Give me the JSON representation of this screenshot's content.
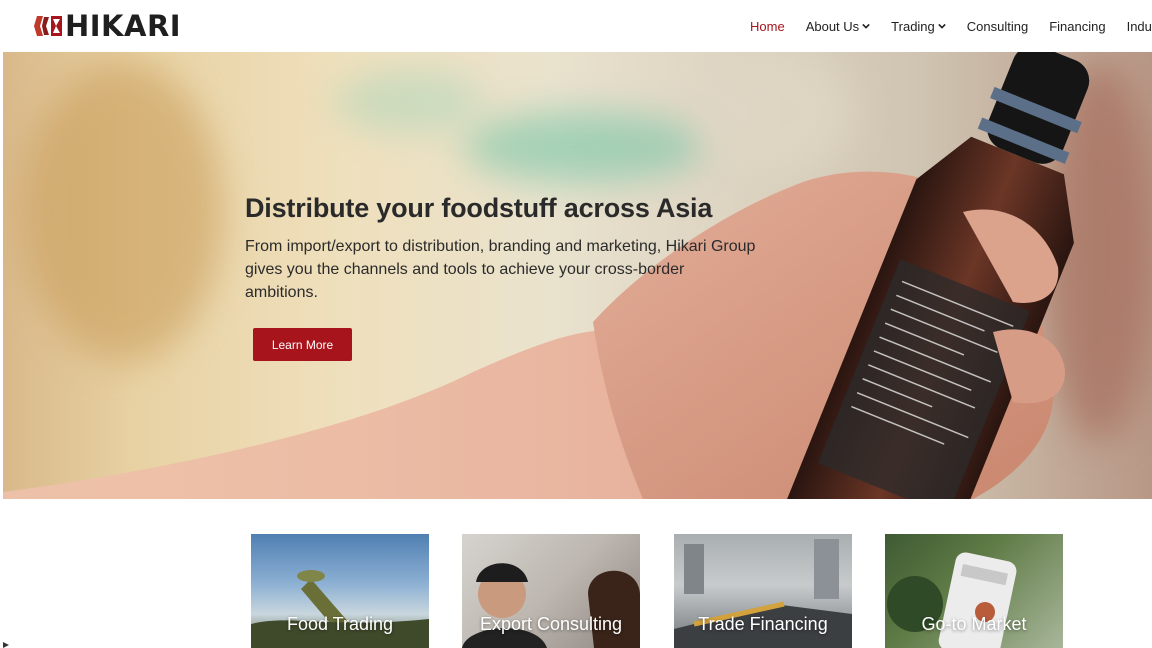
{
  "brand": {
    "name": "HIKARI",
    "accent": "#a8141b"
  },
  "nav": {
    "items": [
      {
        "label": "Home",
        "active": true,
        "dropdown": false
      },
      {
        "label": "About Us",
        "active": false,
        "dropdown": true
      },
      {
        "label": "Trading",
        "active": false,
        "dropdown": true
      },
      {
        "label": "Consulting",
        "active": false,
        "dropdown": false
      },
      {
        "label": "Financing",
        "active": false,
        "dropdown": false
      },
      {
        "label": "Industr",
        "active": false,
        "dropdown": false
      }
    ]
  },
  "hero": {
    "title": "Distribute your foodstuff across Asia",
    "subtitle": "From import/export to distribution, branding and marketing, Hikari Group gives you the channels and tools to achieve your cross-border ambitions.",
    "button_label": "Learn More"
  },
  "cards": [
    {
      "label": "Food Trading"
    },
    {
      "label": "Export Consulting"
    },
    {
      "label": "Trade Financing"
    },
    {
      "label": "Go-to Market"
    }
  ],
  "icons": [
    "logo-mark-icon",
    "chevron-down-icon"
  ]
}
